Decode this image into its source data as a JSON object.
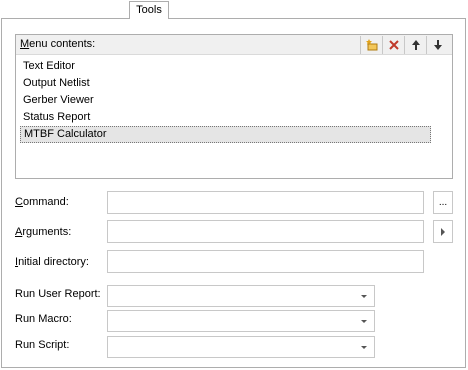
{
  "tab": {
    "label": "Tools"
  },
  "menu": {
    "label_mnemonic": "M",
    "label_rest": "enu contents:",
    "toolbar": [
      {
        "name": "add-menu-item-button",
        "icon": "new-item-icon"
      },
      {
        "name": "delete-menu-item-button",
        "icon": "delete-icon"
      },
      {
        "name": "move-up-button",
        "icon": "arrow-up-icon"
      },
      {
        "name": "move-down-button",
        "icon": "arrow-down-icon"
      }
    ],
    "items": [
      {
        "label": "Text Editor"
      },
      {
        "label": "Output Netlist"
      },
      {
        "label": "Gerber Viewer"
      },
      {
        "label": "Status Report"
      },
      {
        "label": "MTBF Calculator",
        "selected": true
      }
    ]
  },
  "command": {
    "mnemonic": "C",
    "rest": "ommand:",
    "value": "",
    "browse_label": "..."
  },
  "arguments": {
    "mnemonic": "A",
    "rest": "rguments:",
    "value": ""
  },
  "initial_directory": {
    "mnemonic": "I",
    "rest": "nitial directory:",
    "value": ""
  },
  "run_user_report": {
    "label": "Run User Report:",
    "value": ""
  },
  "run_macro": {
    "label": "Run Macro:",
    "value": ""
  },
  "run_script": {
    "label": "Run Script:",
    "value": ""
  },
  "colors": {
    "selection": "#e5e5e5",
    "border": "#adadad",
    "delete_icon": "#c0392b",
    "add_icon": "#e0a21b"
  }
}
